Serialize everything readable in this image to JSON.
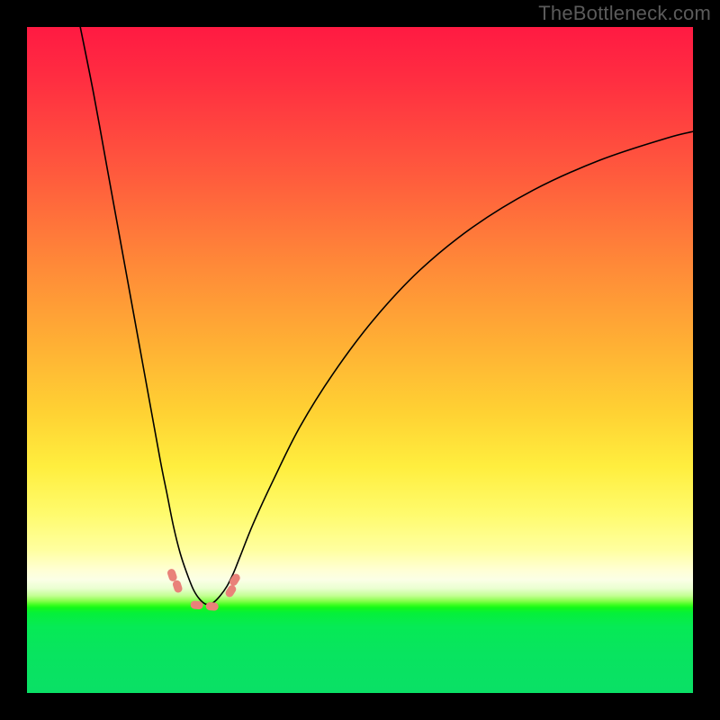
{
  "watermark": "TheBottleneck.com",
  "chart_data": {
    "type": "line",
    "title": "",
    "xlabel": "",
    "ylabel": "",
    "xlim": [
      0,
      100
    ],
    "ylim": [
      0,
      100
    ],
    "grid": false,
    "legend": false,
    "note": "Axes unlabeled; values are normalized 0–100 estimated from pixel positions. y≈0 is bottom (green), y≈100 is top (red). Curve is a V-shaped bottleneck profile with minimum near x≈27.",
    "series": [
      {
        "name": "bottleneck-curve",
        "x": [
          8,
          10,
          12,
          14,
          16,
          18,
          20,
          21,
          22,
          23,
          24,
          25,
          26,
          27,
          28,
          29,
          30,
          31,
          32,
          34,
          37,
          41,
          46,
          52,
          59,
          67,
          76,
          86,
          96,
          100
        ],
        "y": [
          100,
          90,
          79,
          68,
          57,
          46,
          35,
          30,
          25,
          21,
          18,
          15.5,
          14,
          13.3,
          13.6,
          14.6,
          16,
          18,
          20.5,
          25.5,
          32,
          40,
          48,
          56,
          63.5,
          70,
          75.5,
          80,
          83.3,
          84.3
        ]
      }
    ],
    "markers": [
      {
        "name": "left-upper",
        "x": 21.8,
        "y": 17.7
      },
      {
        "name": "left-lower",
        "x": 22.6,
        "y": 16.0
      },
      {
        "name": "bottom-a",
        "x": 25.5,
        "y": 13.2
      },
      {
        "name": "bottom-b",
        "x": 27.8,
        "y": 13.0
      },
      {
        "name": "right-lower",
        "x": 30.6,
        "y": 15.3
      },
      {
        "name": "right-upper",
        "x": 31.2,
        "y": 17.0
      }
    ],
    "background_gradient": {
      "direction": "vertical",
      "stops": [
        {
          "pos": 0.0,
          "color": "#ff1a42"
        },
        {
          "pos": 0.36,
          "color": "#ff8a38"
        },
        {
          "pos": 0.66,
          "color": "#ffee3e"
        },
        {
          "pos": 0.83,
          "color": "#fbffe6"
        },
        {
          "pos": 0.87,
          "color": "#13f81a"
        },
        {
          "pos": 1.0,
          "color": "#0ae066"
        }
      ]
    }
  }
}
